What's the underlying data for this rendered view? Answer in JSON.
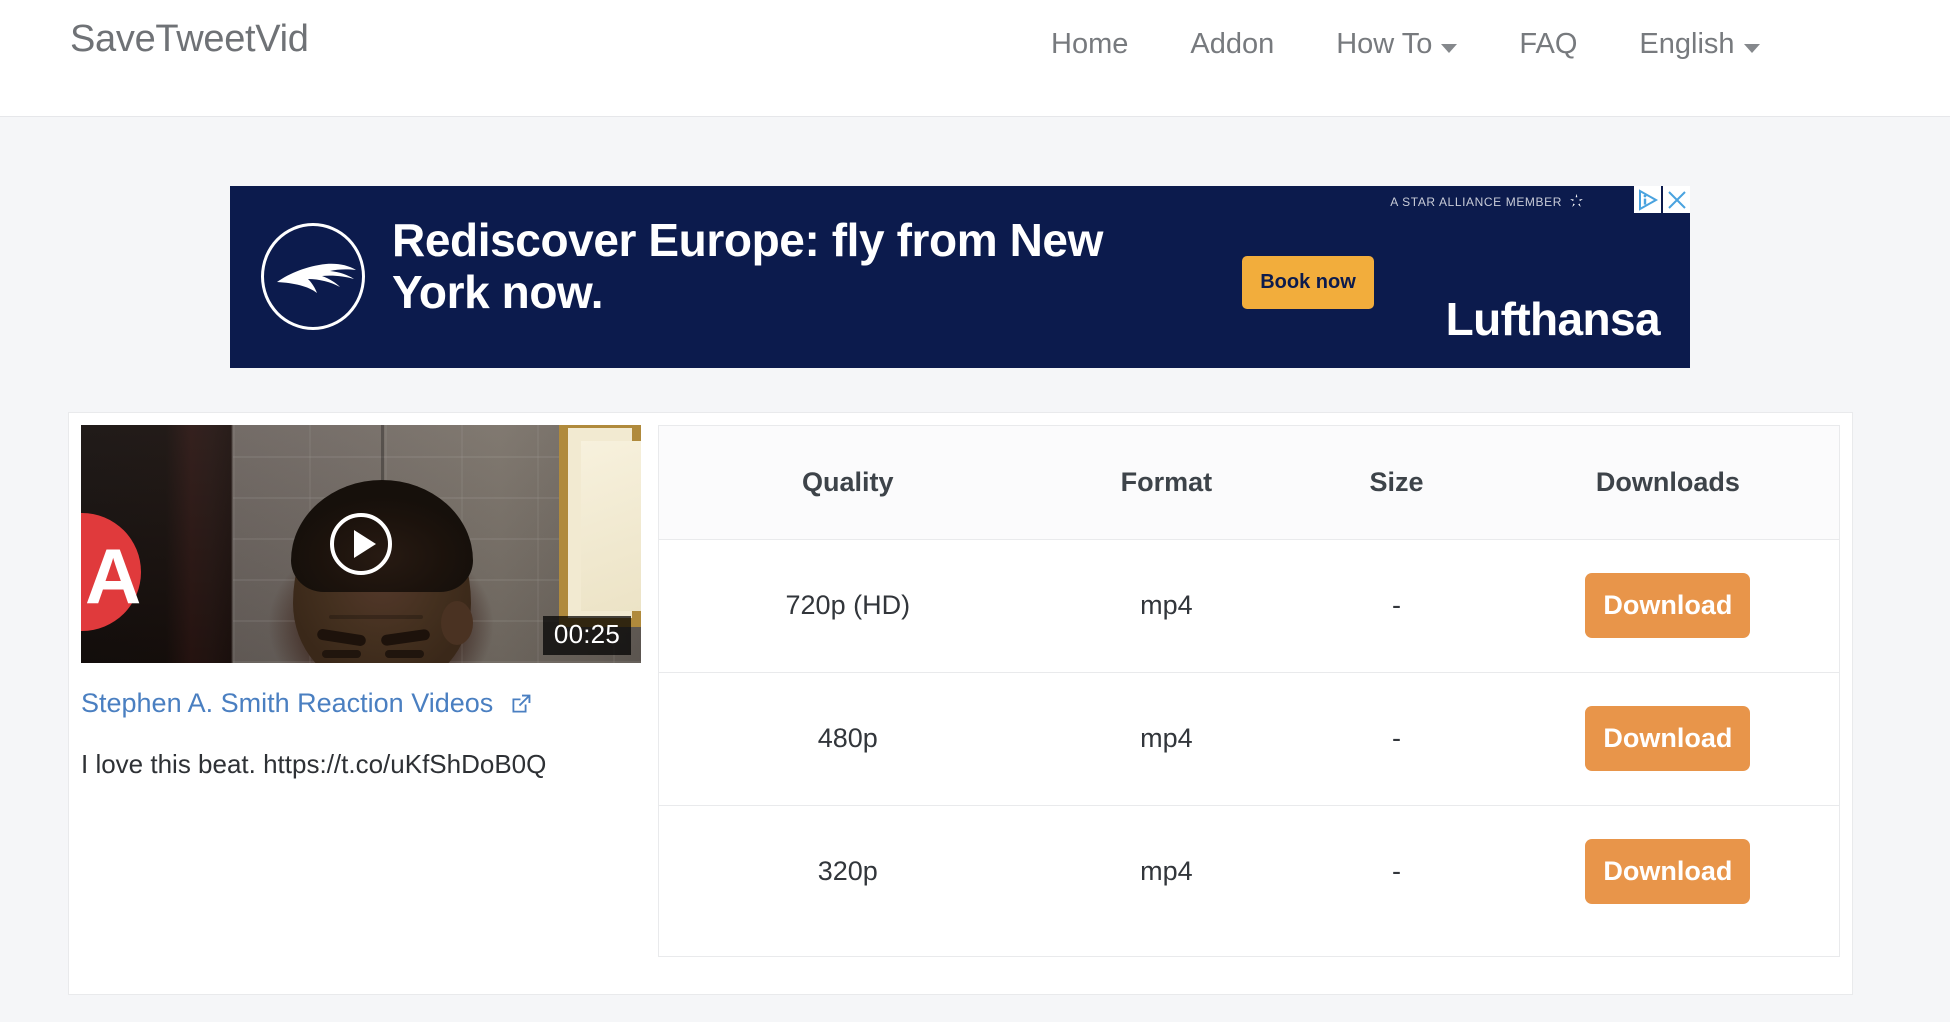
{
  "header": {
    "brand": "SaveTweetVid",
    "nav": [
      {
        "label": "Home",
        "has_caret": false
      },
      {
        "label": "Addon",
        "has_caret": false
      },
      {
        "label": "How To",
        "has_caret": true
      },
      {
        "label": "FAQ",
        "has_caret": false
      },
      {
        "label": "English",
        "has_caret": true
      }
    ]
  },
  "ad": {
    "headline": "Rediscover Europe: fly from New York now.",
    "cta_label": "Book now",
    "brand": "Lufthansa",
    "alliance_text": "A STAR ALLIANCE MEMBER",
    "bg_color": "#0c1b4d",
    "cta_color": "#f2ad3c",
    "adchoices_icon": "adchoices-icon",
    "close_icon": "close-icon"
  },
  "video": {
    "duration": "00:25",
    "title": "Stephen A. Smith Reaction Videos",
    "description": "I love this beat. https://t.co/uKfShDoB0Q",
    "play_icon": "play-icon",
    "external_link_icon": "external-link-icon",
    "title_color": "#4a7fc1"
  },
  "downloads": {
    "columns": [
      "Quality",
      "Format",
      "Size",
      "Downloads"
    ],
    "button_color": "#e8954a",
    "rows": [
      {
        "quality": "720p (HD)",
        "format": "mp4",
        "size": "-",
        "action": "Download"
      },
      {
        "quality": "480p",
        "format": "mp4",
        "size": "-",
        "action": "Download"
      },
      {
        "quality": "320p",
        "format": "mp4",
        "size": "-",
        "action": "Download"
      }
    ]
  }
}
